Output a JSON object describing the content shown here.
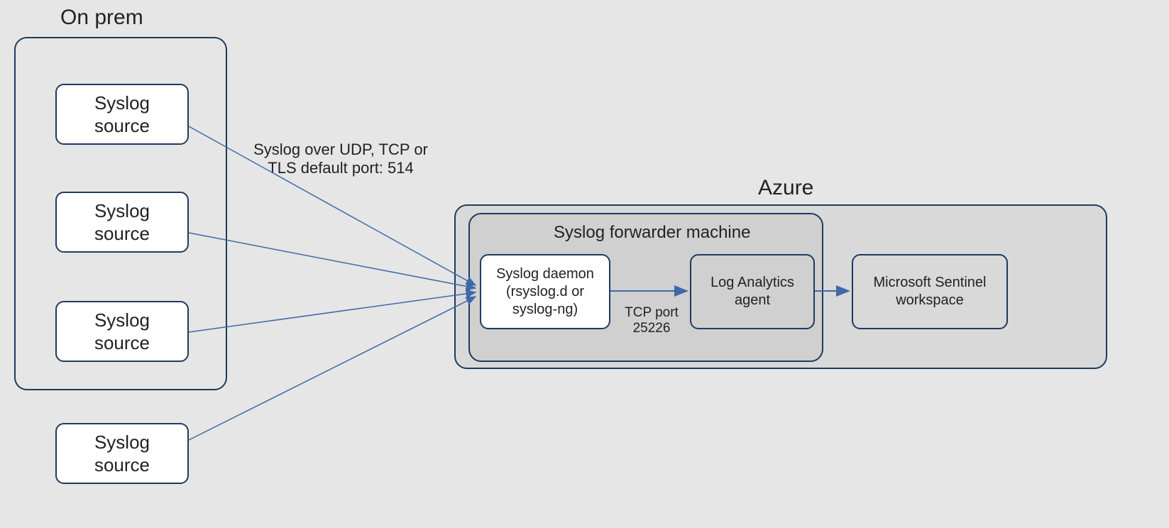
{
  "titles": {
    "onprem": "On prem",
    "azure": "Azure"
  },
  "sources": {
    "s1": "Syslog source",
    "s2": "Syslog source",
    "s3": "Syslog source",
    "s4": "Syslog source"
  },
  "labels": {
    "syslogProtocol": "Syslog over UDP, TCP or TLS default port: 514",
    "tcpPort": "TCP port 25226",
    "forwarderTitle": "Syslog forwarder machine"
  },
  "boxes": {
    "daemon": "Syslog daemon (rsyslog.d or syslog-ng)",
    "laAgent": "Log Analytics agent",
    "sentinel": "Microsoft Sentinel workspace"
  }
}
